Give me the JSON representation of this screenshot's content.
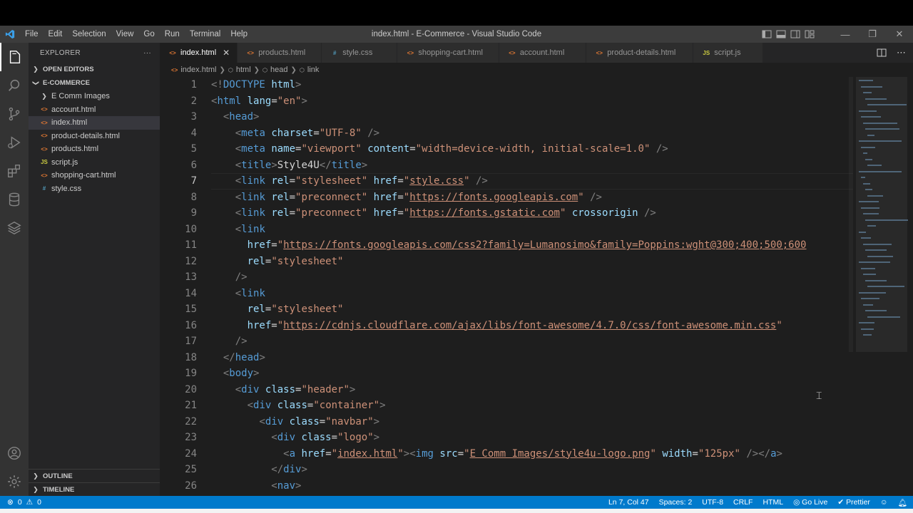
{
  "window": {
    "title": "index.html - E-Commerce - Visual Studio Code",
    "menu": [
      "File",
      "Edit",
      "Selection",
      "View",
      "Go",
      "Run",
      "Terminal",
      "Help"
    ]
  },
  "sidebar": {
    "header": "EXPLORER",
    "more": "···",
    "open_editors": "OPEN EDITORS",
    "project": "E-COMMERCE",
    "folder": "E Comm Images",
    "files": [
      {
        "name": "account.html",
        "type": "html"
      },
      {
        "name": "index.html",
        "type": "html"
      },
      {
        "name": "product-details.html",
        "type": "html"
      },
      {
        "name": "products.html",
        "type": "html"
      },
      {
        "name": "script.js",
        "type": "js"
      },
      {
        "name": "shopping-cart.html",
        "type": "html"
      },
      {
        "name": "style.css",
        "type": "css"
      }
    ],
    "outline": "OUTLINE",
    "timeline": "TIMELINE"
  },
  "tabs": [
    {
      "name": "index.html",
      "type": "html",
      "active": true
    },
    {
      "name": "products.html",
      "type": "html"
    },
    {
      "name": "style.css",
      "type": "css"
    },
    {
      "name": "shopping-cart.html",
      "type": "html"
    },
    {
      "name": "account.html",
      "type": "html"
    },
    {
      "name": "product-details.html",
      "type": "html"
    },
    {
      "name": "script.js",
      "type": "js"
    }
  ],
  "breadcrumb": [
    "index.html",
    "html",
    "head",
    "link"
  ],
  "editor": {
    "current_line": 7,
    "line_numbers": [
      "1",
      "2",
      "3",
      "4",
      "5",
      "6",
      "7",
      "8",
      "9",
      "10",
      "11",
      "12",
      "13",
      "14",
      "15",
      "16",
      "17",
      "18",
      "19",
      "20",
      "21",
      "22",
      "23",
      "24",
      "25",
      "26"
    ]
  },
  "status": {
    "errors": "0",
    "warnings": "0",
    "position": "Ln 7, Col 47",
    "spaces": "Spaces: 2",
    "encoding": "UTF-8",
    "eol": "CRLF",
    "language": "HTML",
    "golive": "Go Live",
    "prettier": "Prettier"
  },
  "colors": {
    "accent": "#007acc",
    "editor_bg": "#1e1e1e",
    "sidebar_bg": "#252526",
    "activity_bg": "#333333"
  }
}
